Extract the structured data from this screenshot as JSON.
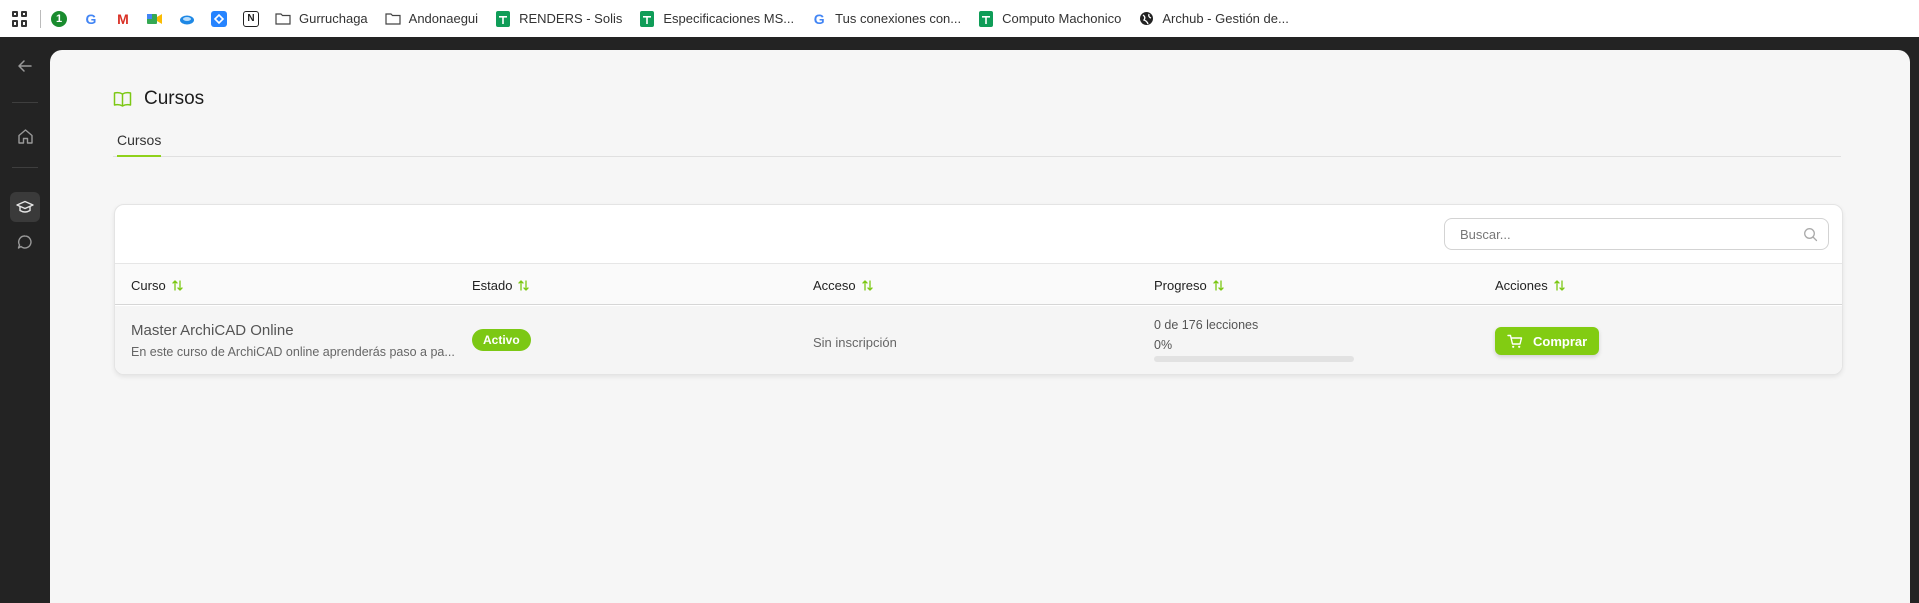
{
  "bookmarks": {
    "items": [
      {
        "label": "Gurruchaga",
        "icon": "folder-icon"
      },
      {
        "label": "Andonaegui",
        "icon": "folder-icon"
      },
      {
        "label": "RENDERS - Solis",
        "icon": "sheets-icon"
      },
      {
        "label": "Especificaciones MS...",
        "icon": "sheets-icon"
      },
      {
        "label": "Tus conexiones con...",
        "icon": "google-icon"
      },
      {
        "label": "Computo Machonico",
        "icon": "sheets-icon"
      },
      {
        "label": "Archub - Gestión de...",
        "icon": "globe-icon"
      }
    ]
  },
  "page": {
    "title": "Cursos",
    "tab": "Cursos"
  },
  "search": {
    "placeholder": "Buscar..."
  },
  "table": {
    "headers": {
      "course": "Curso",
      "status": "Estado",
      "access": "Acceso",
      "progress": "Progreso",
      "actions": "Acciones"
    },
    "rows": [
      {
        "name": "Master ArchiCAD Online",
        "description": "En este curso de ArchiCAD online aprenderás paso a pa...",
        "status": "Activo",
        "access": "Sin inscripción",
        "progress_text": "0 de 176 lecciones",
        "progress_pct": "0%",
        "progress_value": 0,
        "action": "Comprar"
      }
    ]
  },
  "colors": {
    "accent": "#82cc12",
    "sidebar": "#232323",
    "panel": "#f6f6f6"
  }
}
